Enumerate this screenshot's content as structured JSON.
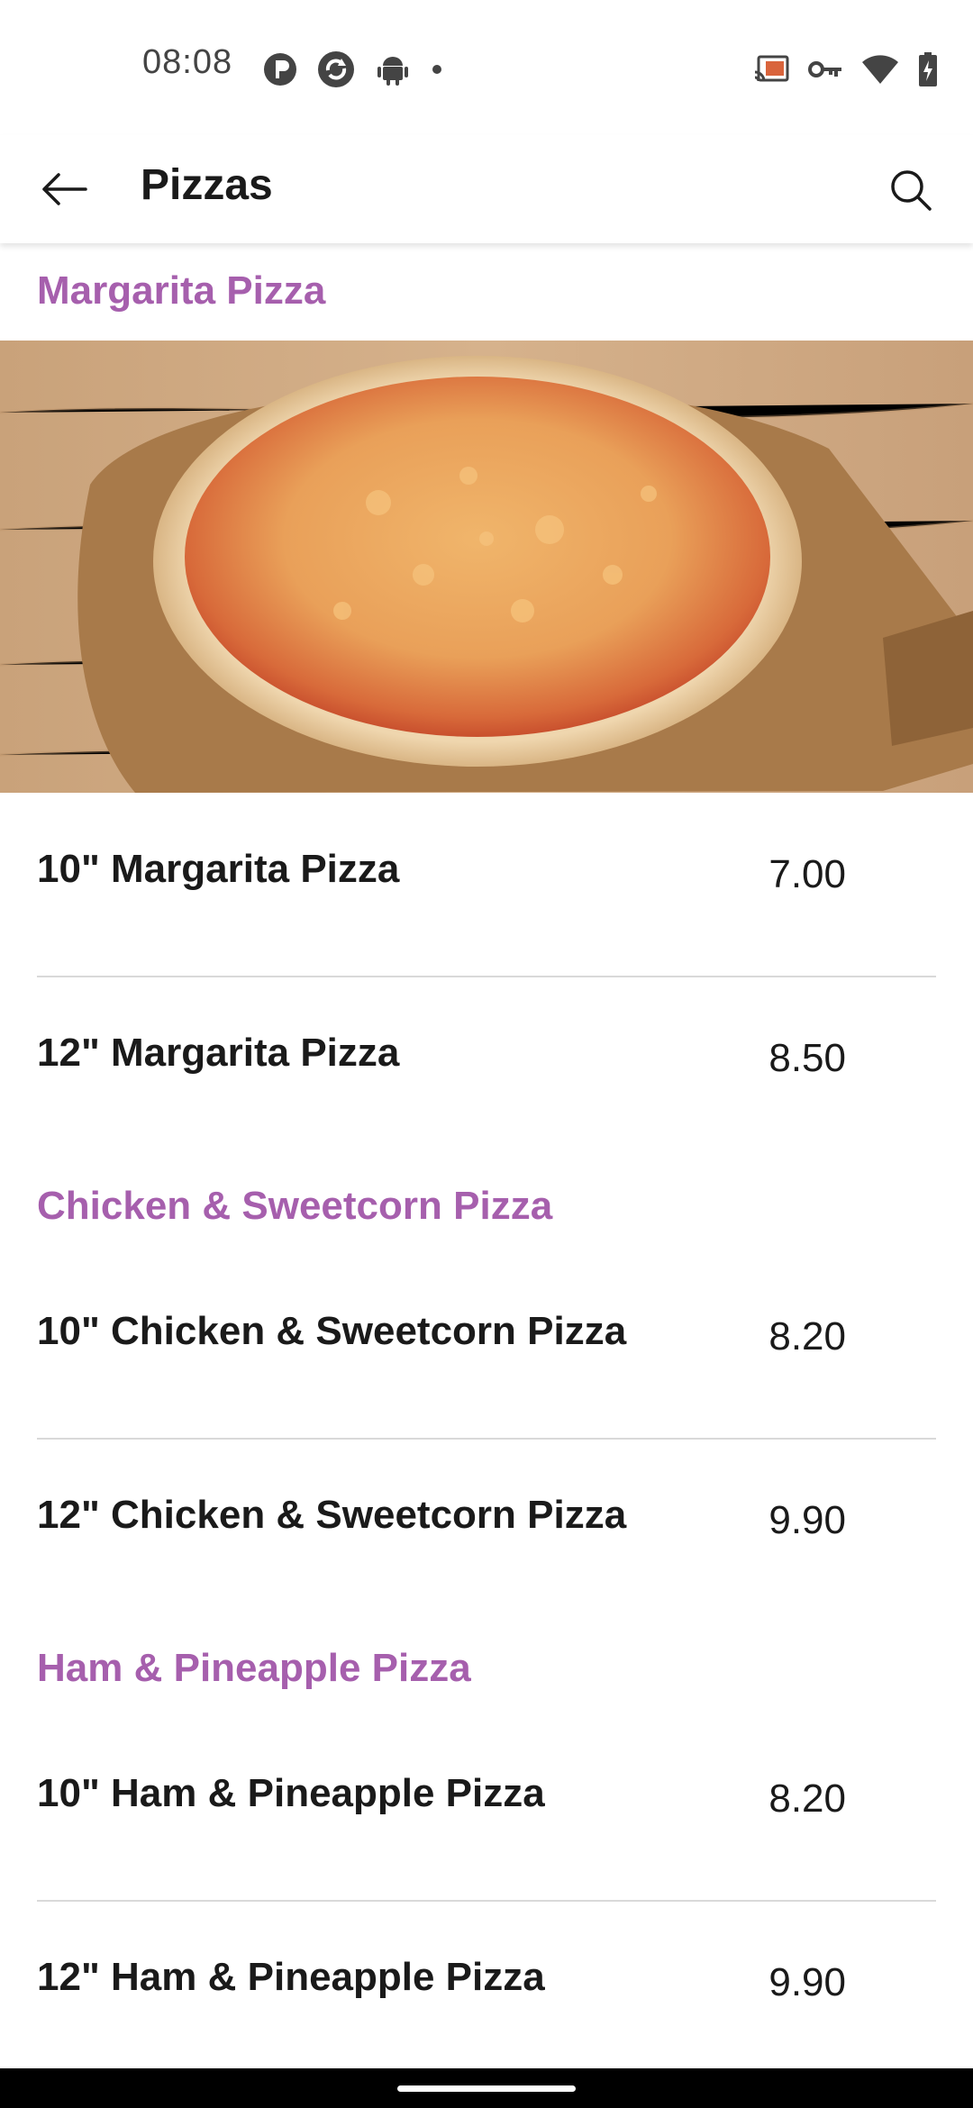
{
  "status_bar": {
    "time": "08:08",
    "left_icons": [
      "p-badge-icon",
      "sync-icon",
      "android-icon",
      "dot-icon"
    ],
    "right_icons": [
      "cast-icon",
      "vpn-key-icon",
      "wifi-icon",
      "battery-charging-icon"
    ]
  },
  "app_bar": {
    "title": "Pizzas",
    "back_icon": "arrow-left-icon",
    "search_icon": "search-icon"
  },
  "sections": [
    {
      "title": "Margarita Pizza",
      "image": "margarita-pizza-photo",
      "items": [
        {
          "name": "10\" Margarita Pizza",
          "price": "7.00"
        },
        {
          "name": "12\" Margarita Pizza",
          "price": "8.50"
        }
      ]
    },
    {
      "title": "Chicken & Sweetcorn Pizza",
      "items": [
        {
          "name": "10\" Chicken & Sweetcorn Pizza",
          "price": "8.20"
        },
        {
          "name": "12\" Chicken & Sweetcorn Pizza",
          "price": "9.90"
        }
      ]
    },
    {
      "title": "Ham & Pineapple Pizza",
      "items": [
        {
          "name": "10\" Ham & Pineapple Pizza",
          "price": "8.20"
        },
        {
          "name": "12\" Ham & Pineapple Pizza",
          "price": "9.90"
        }
      ]
    }
  ],
  "colors": {
    "section_title": "#a65fad",
    "divider": "#d9d9d9",
    "text": "#1a1a1a"
  }
}
